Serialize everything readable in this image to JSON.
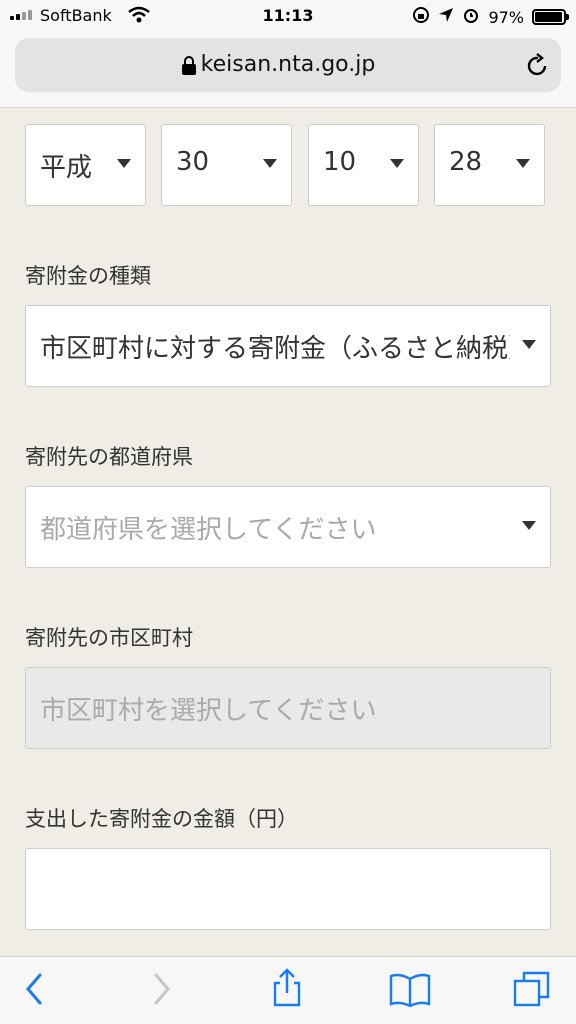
{
  "status": {
    "carrier": "SoftBank",
    "time": "11:13",
    "battery": "97%",
    "battery_level": 0.97
  },
  "browser": {
    "url": "keisan.nta.go.jp"
  },
  "date": {
    "era": "平成",
    "year": "30",
    "month": "10",
    "day": "28"
  },
  "donation_type": {
    "label": "寄附金の種類",
    "value": "市区町村に対する寄附金（ふるさと納税）"
  },
  "prefecture": {
    "label": "寄附先の都道府県",
    "placeholder": "都道府県を選択してください"
  },
  "municipality": {
    "label": "寄附先の市区町村",
    "placeholder": "市区町村を選択してください"
  },
  "amount": {
    "label": "支出した寄附金の金額（円）",
    "value": ""
  },
  "icons": [
    "signal-icon",
    "wifi-icon",
    "lock-icon",
    "reload-icon",
    "back-icon",
    "forward-icon",
    "share-icon",
    "bookmarks-icon",
    "tabs-icon"
  ]
}
